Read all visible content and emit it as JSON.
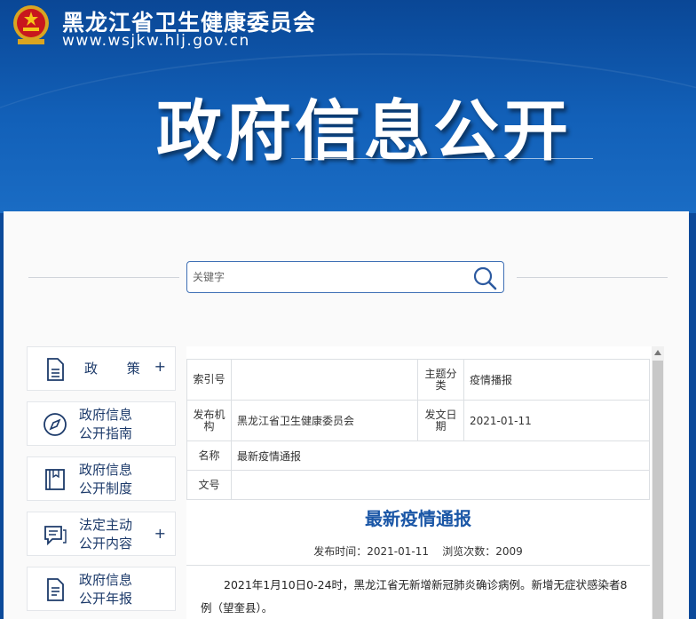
{
  "header": {
    "site_name": "黑龙江省卫生健康委员会",
    "site_url": "www.wsjkw.hlj.gov.cn",
    "page_title": "政府信息公开"
  },
  "search": {
    "placeholder": "关键字",
    "value": ""
  },
  "sidebar": {
    "items": [
      {
        "label": "政 策",
        "icon": "document-icon",
        "has_plus": true,
        "plus": "+"
      },
      {
        "label_line1": "政府信息",
        "label_line2": "公开指南",
        "icon": "compass-icon"
      },
      {
        "label_line1": "政府信息",
        "label_line2": "公开制度",
        "icon": "book-icon"
      },
      {
        "label_line1": "法定主动",
        "label_line2": "公开内容",
        "icon": "chat-icon",
        "has_plus": true,
        "plus": "+"
      },
      {
        "label_line1": "政府信息",
        "label_line2": "公开年报",
        "icon": "report-icon"
      }
    ]
  },
  "meta": {
    "index_label": "索引号",
    "index_value": "",
    "topic_label_1": "主题分",
    "topic_label_2": "类",
    "topic_value": "疫情播报",
    "issuer_label_1": "发布机",
    "issuer_label_2": "构",
    "issuer_value": "黑龙江省卫生健康委员会",
    "date_label_1": "发文日",
    "date_label_2": "期",
    "date_value": "2021-01-11",
    "name_label": "名称",
    "name_value": "最新疫情通报",
    "docno_label": "文号",
    "docno_value": ""
  },
  "document": {
    "title": "最新疫情通报",
    "info": "发布时间：2021-01-11    浏览次数：2009",
    "body": "2021年1月10日0-24时，黑龙江省无新增新冠肺炎确诊病例。新增无症状感染者8例（望奎县）。"
  },
  "colors": {
    "banner": "#0c4a9a",
    "accent": "#1a56a6",
    "sidebar_text": "#1c3a6a"
  }
}
